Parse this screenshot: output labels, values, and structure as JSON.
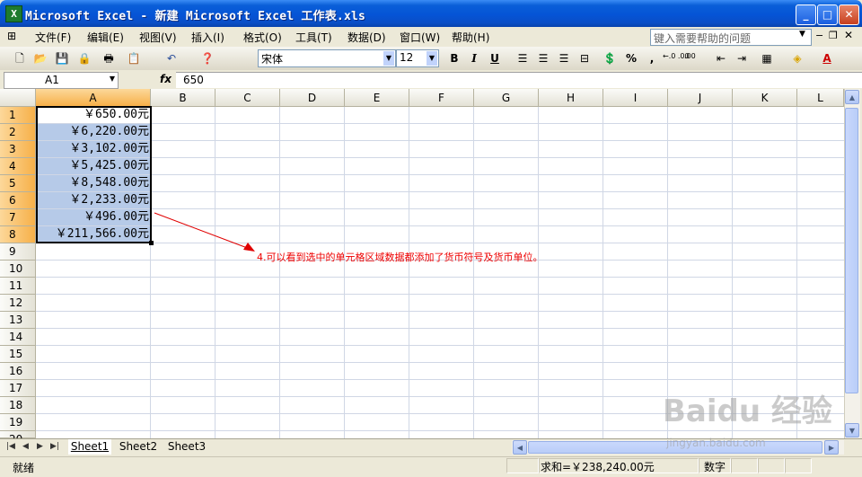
{
  "window": {
    "title": "Microsoft Excel - 新建 Microsoft Excel 工作表.xls",
    "app_icon": "X",
    "minimize_glyph": "_",
    "maximize_glyph": "□",
    "close_glyph": "✕"
  },
  "menu": {
    "items": [
      "文件(F)",
      "编辑(E)",
      "视图(V)",
      "插入(I)",
      "格式(O)",
      "工具(T)",
      "数据(D)",
      "窗口(W)",
      "帮助(H)"
    ],
    "help_placeholder": "键入需要帮助的问题"
  },
  "toolbar": {
    "font_name": "宋体",
    "font_size": "12",
    "bold": "B",
    "italic": "I",
    "underline": "U",
    "percent": "%",
    "comma": ",",
    "inc_decimal": "←.0 .00",
    "dec_decimal": ".00 →.0"
  },
  "formula_bar": {
    "name_box": "A1",
    "fx": "fx",
    "value": "650"
  },
  "grid": {
    "columns": [
      "A",
      "B",
      "C",
      "D",
      "E",
      "F",
      "G",
      "H",
      "I",
      "J",
      "K",
      "L"
    ],
    "rows": [
      "1",
      "2",
      "3",
      "4",
      "5",
      "6",
      "7",
      "8",
      "9",
      "10",
      "11",
      "12",
      "13",
      "14",
      "15",
      "16",
      "17",
      "18",
      "19",
      "20"
    ],
    "column_a_values": [
      "￥650.00元",
      "￥6,220.00元",
      "￥3,102.00元",
      "￥5,425.00元",
      "￥8,548.00元",
      "￥2,233.00元",
      "￥496.00元",
      "￥211,566.00元"
    ]
  },
  "annotation": {
    "text": "4.可以看到选中的单元格区域数据都添加了货币符号及货币单位。",
    "color": "#e00000"
  },
  "sheet_tabs": [
    "Sheet1",
    "Sheet2",
    "Sheet3"
  ],
  "status_bar": {
    "ready": "就绪",
    "sum": "求和=￥238,240.00元",
    "mode": "数字"
  },
  "watermark": {
    "brand": "Baidu 经验",
    "url": "jingyan.baidu.com"
  },
  "colors": {
    "title_bar": "#0554d6",
    "selected_header": "#f7b049",
    "selection_fill": "#b6cae8",
    "chrome": "#ece9d8"
  }
}
